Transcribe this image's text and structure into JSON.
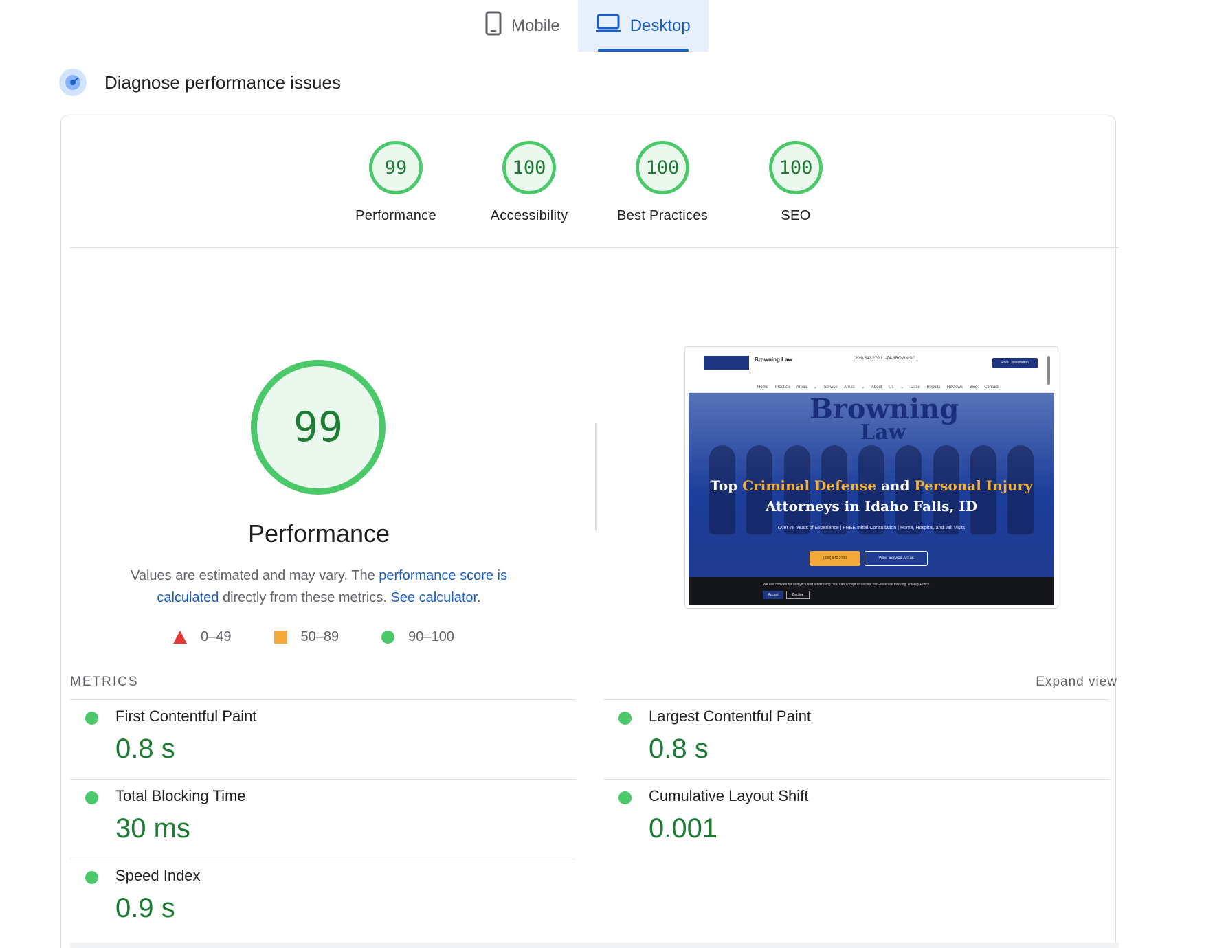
{
  "tabs": [
    {
      "label": "Mobile",
      "icon": "phone-icon",
      "active": false
    },
    {
      "label": "Desktop",
      "icon": "laptop-icon",
      "active": true
    }
  ],
  "section": {
    "title": "Diagnose performance issues",
    "icon": "diagnose-icon"
  },
  "scores": [
    {
      "label": "Performance",
      "value": "99"
    },
    {
      "label": "Accessibility",
      "value": "100"
    },
    {
      "label": "Best Practices",
      "value": "100"
    },
    {
      "label": "SEO",
      "value": "100"
    }
  ],
  "performance": {
    "score": "99",
    "title": "Performance",
    "desc_prefix": "Values are estimated and may vary. The ",
    "link_score": "performance score is calculated",
    "desc_middle": " directly from these metrics. ",
    "link_calculator": "See calculator",
    "desc_suffix": "."
  },
  "legend": [
    {
      "range": "0–49",
      "shape": "triangle",
      "color": "#e53935"
    },
    {
      "range": "50–89",
      "shape": "square",
      "color": "#f4a93c"
    },
    {
      "range": "90–100",
      "shape": "circle",
      "color": "#4bc86a"
    }
  ],
  "screenshot": {
    "brand": "Browning Law",
    "phone": "(208) 542-2700   1-74-BROWNING",
    "cta": "Free Consultation",
    "menu": "Home  Practice Areas ⌄  Service Areas ⌄  About Us ⌄  Case Results  Reviews  Blog  Contact",
    "hero_brand": "Browning",
    "hero_law": "Law",
    "headline_1a": "Top ",
    "headline_1b": "Criminal Defense",
    "headline_1c": " and ",
    "headline_1d": "Personal Injury",
    "headline_2": "Attorneys in Idaho Falls, ID",
    "subline": "Over 78 Years of Experience | FREE Initial Consultation | Home, Hospital, and Jail Visits",
    "btn_phone": "(208) 542-2700",
    "btn_areas": "View Service Areas",
    "cookie": "We use cookies for analytics and advertising. You can accept or decline non-essential tracking. Privacy Policy",
    "accept": "Accept",
    "decline": "Decline"
  },
  "metrics_header": "METRICS",
  "expand_label": "Expand view",
  "metrics": [
    {
      "label": "First Contentful Paint",
      "value": "0.8 s",
      "status": "good"
    },
    {
      "label": "Largest Contentful Paint",
      "value": "0.8 s",
      "status": "good"
    },
    {
      "label": "Total Blocking Time",
      "value": "30 ms",
      "status": "good"
    },
    {
      "label": "Cumulative Layout Shift",
      "value": "0.001",
      "status": "good"
    },
    {
      "label": "Speed Index",
      "value": "0.9 s",
      "status": "good"
    }
  ],
  "colors": {
    "good": "#4bc86a",
    "average": "#f4a93c",
    "poor": "#e53935",
    "link": "#1a5fc8"
  }
}
